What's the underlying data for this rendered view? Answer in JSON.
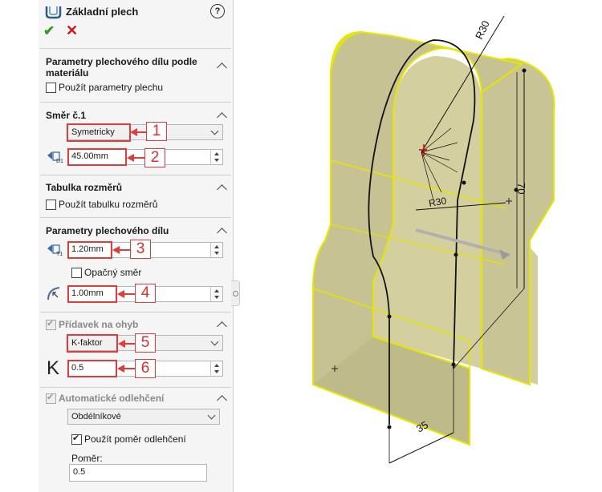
{
  "header": {
    "title": "Základní plech",
    "help": "?"
  },
  "actions": {
    "ok": "✔",
    "cancel": "✕"
  },
  "sections": {
    "material": {
      "title": "Parametry plechového dílu podle materiálu",
      "checkbox_label": "Použít parametry plechu",
      "checked": false
    },
    "direction": {
      "title": "Směr č.1",
      "mode": "Symetricky",
      "depth": "45.00mm"
    },
    "table": {
      "title": "Tabulka rozměrů",
      "checkbox_label": "Použít tabulku rozměrů",
      "checked": false
    },
    "params": {
      "title": "Parametry plechového dílu",
      "thickness": "1.20mm",
      "reverse_label": "Opačný směr",
      "reverse_checked": false,
      "radius": "1.00mm"
    },
    "bend": {
      "title": "Přídavek na ohyb",
      "checked": true,
      "type": "K-faktor",
      "k_symbol": "K",
      "k_value": "0.5"
    },
    "relief": {
      "title": "Automatické odlehčení",
      "checked": true,
      "type": "Obdélníkové",
      "ratio_checkbox_label": "Použít poměr odlehčení",
      "ratio_checked": true,
      "ratio_label": "Poměr:",
      "ratio_value": "0.5"
    }
  },
  "callouts": [
    "1",
    "2",
    "3",
    "4",
    "5",
    "6"
  ],
  "viewport": {
    "dim_r30_top": "R30",
    "dim_r30_mid": "R30",
    "dim_70": "70",
    "dim_35": "35"
  },
  "colors": {
    "accent": "#e03c3c",
    "sheet_edge": "#e6e600",
    "sheet_face": "#c9c496"
  }
}
